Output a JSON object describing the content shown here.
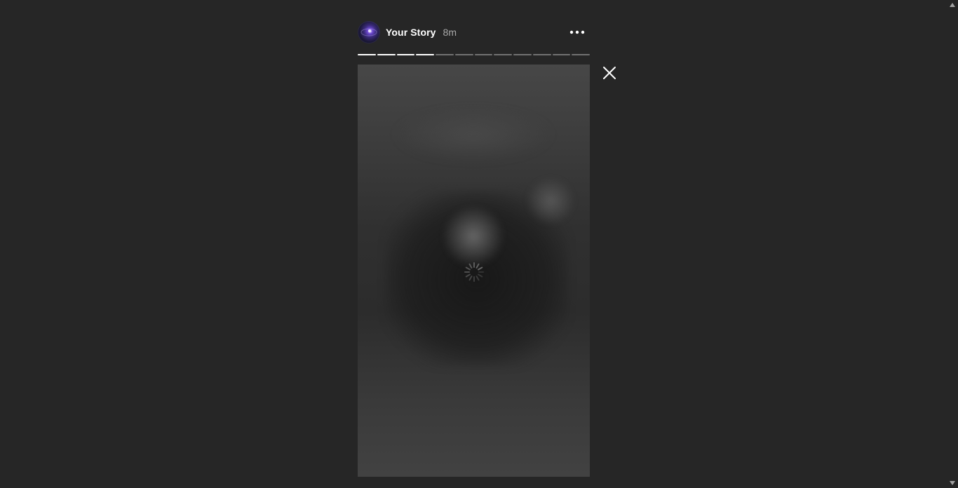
{
  "story": {
    "username": "Your Story",
    "time_ago": "8m",
    "progress": {
      "total_segments": 12,
      "completed_segments": 4
    }
  },
  "icons": {
    "avatar": "avatar-image",
    "more": "more-options-icon",
    "close": "close-icon",
    "loading": "loading-spinner-icon",
    "scroll_up": "scroll-up-arrow-icon",
    "scroll_down": "scroll-down-arrow-icon"
  },
  "colors": {
    "background": "#262626",
    "text_primary": "#ffffff",
    "text_secondary": "#a8a8a8"
  }
}
